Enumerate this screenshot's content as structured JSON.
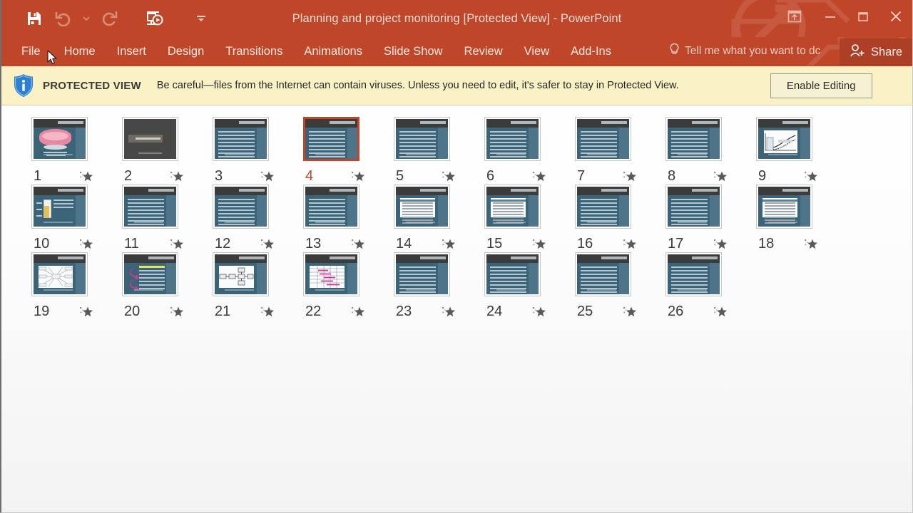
{
  "window": {
    "title": "Planning and project monitoring [Protected View] - PowerPoint",
    "quick_access": [
      {
        "name": "save-icon",
        "label": "Save",
        "enabled": true
      },
      {
        "name": "undo-icon",
        "label": "Undo",
        "enabled": false
      },
      {
        "name": "undo-dropdown-icon",
        "label": "Undo options",
        "enabled": false
      },
      {
        "name": "redo-icon",
        "label": "Redo",
        "enabled": false
      },
      {
        "name": "start-from-beginning-icon",
        "label": "Start From Beginning",
        "enabled": true
      },
      {
        "name": "customize-quick-access-toolbar-icon",
        "label": "Customize Quick Access Toolbar",
        "enabled": true
      }
    ],
    "controls": [
      {
        "name": "ribbon-display-options-icon",
        "label": "Ribbon Display Options"
      },
      {
        "name": "minimize-icon",
        "label": "Minimize"
      },
      {
        "name": "restore-icon",
        "label": "Restore Down"
      },
      {
        "name": "close-icon",
        "label": "Close"
      }
    ]
  },
  "ribbon": {
    "tabs": [
      {
        "label": "File"
      },
      {
        "label": "Home"
      },
      {
        "label": "Insert"
      },
      {
        "label": "Design"
      },
      {
        "label": "Transitions"
      },
      {
        "label": "Animations"
      },
      {
        "label": "Slide Show"
      },
      {
        "label": "Review"
      },
      {
        "label": "View"
      },
      {
        "label": "Add-Ins"
      }
    ],
    "tell_me": "Tell me what you want to dc",
    "share_label": "Share"
  },
  "protected_view": {
    "badge": "PROTECTED VIEW",
    "message": "Be careful—files from the Internet can contain viruses. Unless you need to edit, it's safer to stay in Protected View.",
    "enable_button": "Enable Editing"
  },
  "colors": {
    "titlebar": "#c0462a",
    "banner": "#faf2c4",
    "selection": "#c0462a",
    "thumb_body": "#3c6478",
    "thumb_header": "#3b3b3b"
  },
  "slides": {
    "selected": 4,
    "rows": [
      [
        {
          "num": "1",
          "style": "image",
          "star": "star-icon"
        },
        {
          "num": "2",
          "style": "dark",
          "star": "star-icon"
        },
        {
          "num": "3",
          "style": "bullets",
          "star": "star-icon"
        },
        {
          "num": "4",
          "style": "bullets",
          "star": "star-icon"
        },
        {
          "num": "5",
          "style": "bullets",
          "star": "star-icon"
        },
        {
          "num": "6",
          "style": "bullets",
          "star": "star-icon"
        },
        {
          "num": "7",
          "style": "bullets",
          "star": "star-icon"
        },
        {
          "num": "8",
          "style": "bullets",
          "star": "star-icon"
        },
        {
          "num": "9",
          "style": "chart",
          "star": "star-icon"
        }
      ],
      [
        {
          "num": "10",
          "style": "gauge",
          "star": "star-icon"
        },
        {
          "num": "11",
          "style": "bullets",
          "star": "star-icon"
        },
        {
          "num": "12",
          "style": "bullets",
          "star": "star-icon"
        },
        {
          "num": "13",
          "style": "bullets",
          "star": "star-icon"
        },
        {
          "num": "14",
          "style": "table",
          "star": "star-icon"
        },
        {
          "num": "15",
          "style": "table",
          "star": "star-icon"
        },
        {
          "num": "16",
          "style": "bullets",
          "star": "star-icon"
        },
        {
          "num": "17",
          "style": "bullets",
          "star": "star-icon"
        },
        {
          "num": "18",
          "style": "table",
          "star": "star-icon"
        }
      ],
      [
        {
          "num": "19",
          "style": "diagram",
          "star": "star-icon"
        },
        {
          "num": "20",
          "style": "arrows",
          "star": "star-icon"
        },
        {
          "num": "21",
          "style": "flow",
          "star": "star-icon"
        },
        {
          "num": "22",
          "style": "gantt",
          "star": "star-icon"
        },
        {
          "num": "23",
          "style": "bullets",
          "star": "star-icon"
        },
        {
          "num": "24",
          "style": "bullets",
          "star": "star-icon"
        },
        {
          "num": "25",
          "style": "bullets",
          "star": "star-icon"
        },
        {
          "num": "26",
          "style": "bullets",
          "star": "star-icon"
        }
      ]
    ]
  }
}
